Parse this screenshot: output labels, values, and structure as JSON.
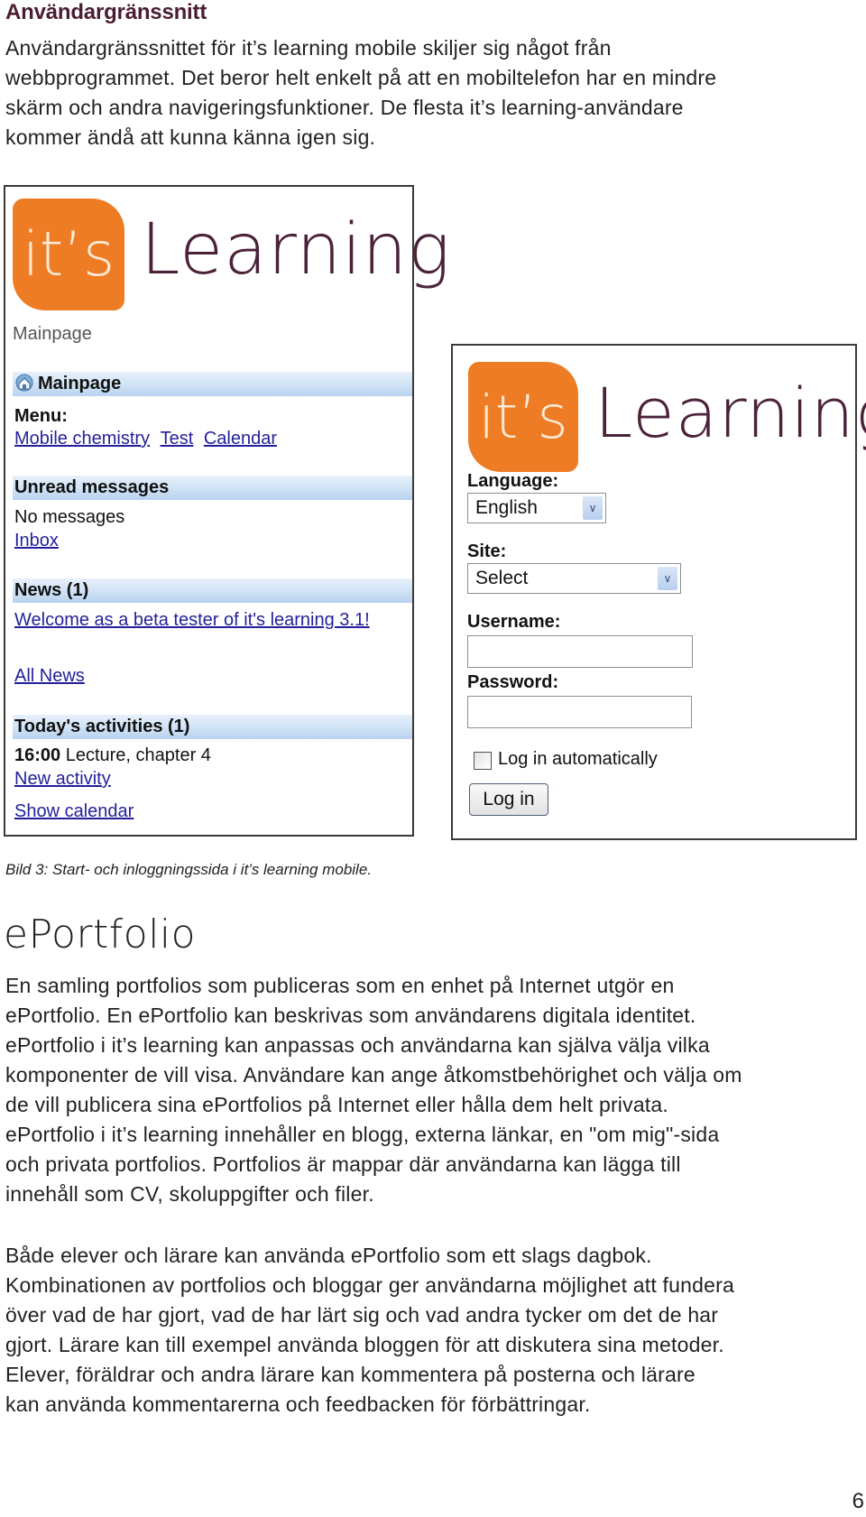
{
  "section": {
    "heading": "Användargränssnitt",
    "intro_lines": [
      "Användargränssnittet för it’s learning mobile skiljer sig något från",
      "webbprogrammet. Det beror helt enkelt på att en mobiltelefon har en mindre",
      "skärm och andra navigeringsfunktioner. De flesta it’s learning-användare",
      "kommer ändå att kunna känna igen sig."
    ]
  },
  "logo": {
    "badge": "it’s",
    "word": "Learning",
    "badge_color": "#ee7c24",
    "word_color": "#4b2239"
  },
  "mainpage_screen": {
    "breadcrumb": "Mainpage",
    "mainpage_bar": "Mainpage",
    "menu_label": "Menu:",
    "menu_links": [
      "Mobile chemistry",
      "Test",
      "Calendar"
    ],
    "unread_bar": "Unread messages",
    "no_messages": "No messages",
    "inbox_link": "Inbox",
    "news_bar": "News (1)",
    "news_item": "Welcome as a beta tester of it's learning 3.1!",
    "all_news_link": "All News",
    "activities_bar": "Today's activities (1)",
    "activity_time": "16:00",
    "activity_title": "Lecture, chapter 4",
    "new_activity_link": "New activity",
    "show_calendar_link": "Show calendar"
  },
  "login_screen": {
    "language_label": "Language:",
    "language_value": "English",
    "site_label": "Site:",
    "site_value": "Select",
    "username_label": "Username:",
    "username_value": "",
    "password_label": "Password:",
    "password_value": "",
    "auto_login_label": "Log in automatically",
    "auto_login_checked": false,
    "login_button": "Log in"
  },
  "caption": "Bild 3: Start- och inloggningssida i it’s learning mobile.",
  "eportfolio": {
    "heading": "ePortfolio",
    "para1_lines": [
      "En samling portfolios som publiceras som en enhet på Internet utgör en",
      "ePortfolio. En ePortfolio kan beskrivas som användarens digitala identitet.",
      "ePortfolio i it’s learning kan anpassas och användarna kan själva välja vilka",
      "komponenter de vill visa. Användare kan ange åtkomstbehörighet och välja om",
      "de vill publicera sina ePortfolios på Internet eller hålla dem helt privata.",
      "ePortfolio i it’s learning innehåller en blogg, externa länkar, en \"om mig\"-sida",
      "och privata portfolios. Portfolios är mappar där användarna kan lägga till",
      "innehåll som CV, skoluppgifter och filer."
    ],
    "para2_lines": [
      "Både elever och lärare kan använda ePortfolio som ett slags dagbok.",
      "Kombinationen av portfolios och bloggar ger användarna möjlighet att fundera",
      "över vad de har gjort, vad de har lärt sig och vad andra tycker om det de har",
      "gjort. Lärare kan till exempel använda bloggen för att diskutera sina metoder.",
      "Elever, föräldrar och andra lärare kan kommentera på posterna och lärare",
      "kan använda kommentarerna och feedbacken för förbättringar."
    ]
  },
  "page_number": "6"
}
